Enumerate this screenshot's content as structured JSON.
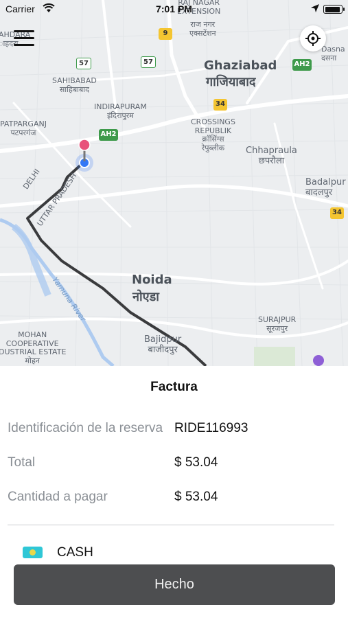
{
  "status_bar": {
    "carrier": "Carrier",
    "time": "7:01 PM",
    "battery_level": 0.95
  },
  "map": {
    "labels": {
      "raj_nagar": "RAJ NAGAR\nEXTENSION",
      "raj_nagar_hi": "राज नगर\nएक्सटेंशन",
      "ahdara": "AHDARA\nाहदरा",
      "ghaziabad": "Ghaziabad",
      "ghaziabad_hi": "गाजियाबाद",
      "dasna": "Dasna\nदसना",
      "sahibabad": "SAHIBABAD\nसाहिबाबाद",
      "indirapuram": "INDIRAPURAM\nइंदिरापुरम",
      "crossings": "CROSSINGS\nREPUBLIK\nक्रॉसिंग्स\nरेपुब्लीक",
      "patparganj": "PATPARGANJ\nपटपरगंज",
      "chhapraula": "Chhapraula\nछपरौला",
      "delhi": "DELHI",
      "uttar_pradesh": "UTTAR PRADESH",
      "badalpur": "Badalpur\nबादलपुर",
      "noida": "Noida",
      "noida_hi": "नोएडा",
      "yamuna": "Yamuna River",
      "surajpur": "SURAJPUR\nसूरजपुर",
      "mohan": "MOHAN\nCOOPERATIVE\nDUSTRIAL ESTATE\nमोहन",
      "bajidpur": "Bajidpur\nबाजीदपुर"
    },
    "shields": {
      "nh9": "9",
      "nh57a": "57",
      "nh57b": "57",
      "ah2a": "AH2",
      "ah2b": "AH2",
      "nh34a": "34",
      "nh34b": "34"
    }
  },
  "invoice": {
    "title": "Factura",
    "rows": [
      {
        "label": "Identificación de la reserva",
        "value": "RIDE116993"
      },
      {
        "label": "Total",
        "value": "$ 53.04"
      },
      {
        "label": "Cantidad a pagar",
        "value": "$ 53.04"
      }
    ],
    "payment_method": "CASH",
    "done_button": "Hecho"
  },
  "colors": {
    "route": "#3a3b3d",
    "button_bg": "#4d4e50",
    "pin_pink": "#e8517a",
    "location_blue": "#3478f6",
    "destination_purple": "#8e5fd6"
  },
  "icons": [
    "wifi-icon",
    "location-arrow-icon",
    "battery-icon",
    "hamburger-menu-icon",
    "locate-me-icon",
    "cash-icon"
  ]
}
